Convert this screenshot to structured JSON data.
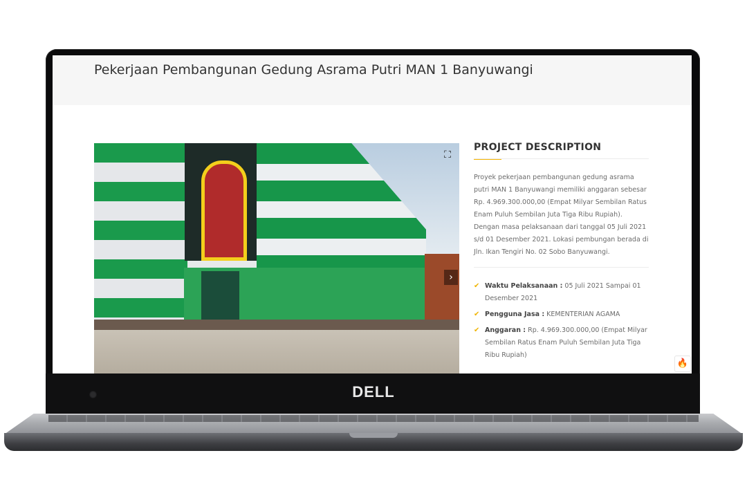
{
  "page": {
    "title": "Pekerjaan Pembangunan Gedung Asrama Putri MAN 1 Banyuwangi"
  },
  "laptop": {
    "brand": "DELL"
  },
  "slider": {
    "image_alt": "Gedung Asrama Putri MAN 1 Banyuwangi",
    "fullscreen_icon": "⛶",
    "next_icon": "›"
  },
  "description": {
    "heading": "PROJECT DESCRIPTION",
    "text": "Proyek pekerjaan pembangunan gedung asrama putri MAN 1 Banyuwangi memiliki anggaran sebesar Rp. 4.969.300.000,00 (Empat Milyar Sembilan Ratus Enam Puluh Sembilan Juta Tiga Ribu Rupiah). Dengan masa pelaksanaan dari tanggal 05 Juli 2021 s/d 01 Desember 2021. Lokasi pembungan berada di Jln. Ikan Tengiri No. 02 Sobo Banyuwangi.",
    "details": [
      {
        "label": "Waktu Pelaksanaan :",
        "value": "05 Juli 2021 Sampai 01 Desember 2021"
      },
      {
        "label": "Pengguna Jasa :",
        "value": "KEMENTERIAN AGAMA"
      },
      {
        "label": "Anggaran :",
        "value": "Rp. 4.969.300.000,00 (Empat Milyar Sembilan Ratus Enam Puluh Sembilan Juta Tiga Ribu Rupiah)"
      }
    ],
    "check_icon": "✔"
  },
  "badge": {
    "icon": "🔥"
  },
  "colors": {
    "accent": "#f4b400",
    "building_green": "#17964a"
  }
}
